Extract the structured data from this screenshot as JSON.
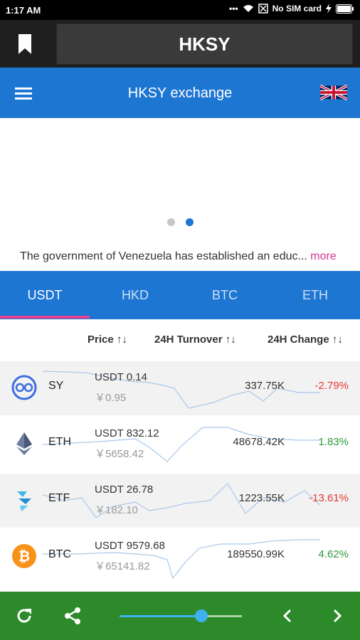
{
  "status": {
    "time": "1:17 AM",
    "carrier": "No SIM card"
  },
  "header": {
    "title": "HKSY"
  },
  "appbar": {
    "title": "HKSY exchange"
  },
  "news": {
    "text": "The government of Venezuela has established an educ...",
    "more": "more"
  },
  "tabs": [
    {
      "label": "USDT",
      "active": true
    },
    {
      "label": "HKD",
      "active": false
    },
    {
      "label": "BTC",
      "active": false
    },
    {
      "label": "ETH",
      "active": false
    }
  ],
  "table": {
    "headers": {
      "price": "Price ↑↓",
      "turnover": "24H Turnover ↑↓",
      "change": "24H Change ↑↓"
    },
    "rows": [
      {
        "symbol": "SY",
        "price": "USDT 0.14",
        "cny": "￥0.95",
        "turnover": "337.75K",
        "change": "-2.79%",
        "direction": "down",
        "icon": "sy-coin-icon"
      },
      {
        "symbol": "ETH",
        "price": "USDT 832.12",
        "cny": "￥5658.42",
        "turnover": "48678.42K",
        "change": "1.83%",
        "direction": "up",
        "icon": "eth-coin-icon"
      },
      {
        "symbol": "ETF",
        "price": "USDT 26.78",
        "cny": "￥182.10",
        "turnover": "1223.55K",
        "change": "-13.61%",
        "direction": "down",
        "icon": "etf-coin-icon"
      },
      {
        "symbol": "BTC",
        "price": "USDT 9579.68",
        "cny": "￥65141.82",
        "turnover": "189550.99K",
        "change": "4.62%",
        "direction": "up",
        "icon": "btc-coin-icon"
      }
    ]
  },
  "colors": {
    "primary": "#1e76d3",
    "accent": "#e8408c",
    "up": "#2e9a3a",
    "down": "#e53935",
    "bottombar": "#2c8a2a"
  },
  "bottom": {
    "icons": [
      "refresh-icon",
      "share-icon",
      "chevron-left-icon",
      "chevron-right-icon"
    ],
    "slider_level": 0.67
  }
}
